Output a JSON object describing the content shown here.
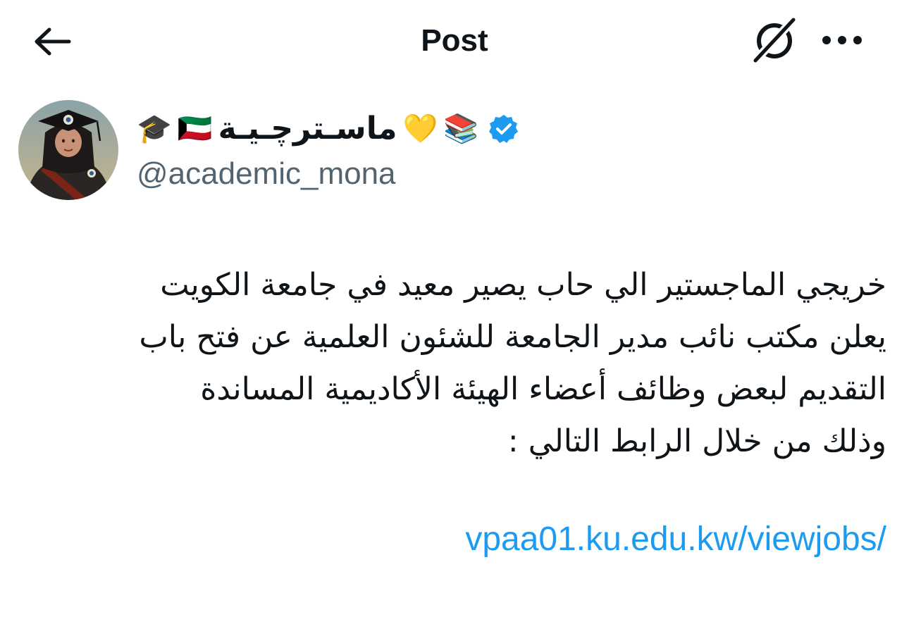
{
  "header": {
    "title": "Post",
    "back_icon": "arrow-left-icon",
    "grok_icon": "grok-icon",
    "more_icon": "more-horizontal-icon"
  },
  "author": {
    "display_name": "ماسـترچـيـة",
    "emoji_before_name": [
      "🎓",
      "🇰🇼"
    ],
    "emoji_after_name": [
      "💛",
      "📚"
    ],
    "handle": "@academic_mona",
    "verified": true,
    "verified_color": "#1d9bf0"
  },
  "post": {
    "text": "خريجي الماجستير الي حاب يصير معيد في جامعة الكويت\nيعلن مكتب نائب مدير الجامعة للشئون العلمية عن فتح باب\nالتقديم لبعض وظائف أعضاء الهيئة الأكاديمية المساندة\nوذلك من خلال الرابط التالي :",
    "link": "vpaa01.ku.edu.kw/viewjobs/"
  },
  "colors": {
    "text": "#0f1419",
    "secondary": "#536471",
    "link": "#1d9bf0",
    "background": "#ffffff"
  }
}
